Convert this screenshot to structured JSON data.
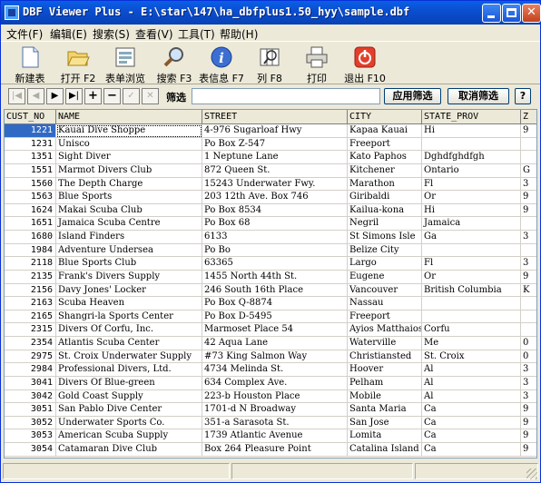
{
  "window": {
    "title": "DBF Viewer Plus - E:\\star\\147\\ha_dbfplus1.50_hyy\\sample.dbf"
  },
  "menu": [
    "文件(F)",
    "编辑(E)",
    "搜索(S)",
    "查看(V)",
    "工具(T)",
    "帮助(H)"
  ],
  "toolbar": [
    {
      "label": "新建表",
      "icon": "new-table-icon"
    },
    {
      "label": "打开 F2",
      "icon": "open-folder-icon"
    },
    {
      "label": "表单浏览",
      "icon": "form-view-icon"
    },
    {
      "label": "搜索 F3",
      "icon": "search-icon"
    },
    {
      "label": "表信息 F7",
      "icon": "info-icon"
    },
    {
      "label": "列 F8",
      "icon": "columns-icon"
    },
    {
      "label": "打印",
      "icon": "print-icon"
    },
    {
      "label": "退出 F10",
      "icon": "exit-icon"
    }
  ],
  "navigator": {
    "buttons": [
      "first-record",
      "prev-record",
      "next-record",
      "last-record",
      "add-record",
      "delete-record",
      "edit-record",
      "cancel-edit"
    ],
    "filter_label": "筛选",
    "filter_value": "",
    "apply_filter": "应用筛选",
    "cancel_filter": "取消筛选",
    "help": "?"
  },
  "grid": {
    "columns": [
      "CUST_NO",
      "NAME",
      "STREET",
      "CITY",
      "STATE_PROV",
      "Z"
    ],
    "rows": [
      [
        "1221",
        "Kauai Dive Shoppe",
        "4-976 Sugarloaf Hwy",
        "Kapaa Kauai",
        "Hi",
        "9"
      ],
      [
        "1231",
        "Unisco",
        "Po Box Z-547",
        "Freeport",
        "",
        ""
      ],
      [
        "1351",
        "Sight Diver",
        "1 Neptune Lane",
        "Kato Paphos",
        "Dghdfghdfgh",
        ""
      ],
      [
        "1551",
        "Marmot Divers Club",
        "872 Queen St.",
        "Kitchener",
        "Ontario",
        "G"
      ],
      [
        "1560",
        "The Depth Charge",
        "15243 Underwater Fwy.",
        "Marathon",
        "Fl",
        "3"
      ],
      [
        "1563",
        "Blue Sports",
        "203 12th Ave. Box 746",
        "Giribaldi",
        "Or",
        "9"
      ],
      [
        "1624",
        "Makai Scuba Club",
        "Po Box 8534",
        "Kailua-kona",
        "Hi",
        "9"
      ],
      [
        "1651",
        "Jamaica Scuba Centre",
        "Po Box 68",
        "Negril",
        "Jamaica",
        ""
      ],
      [
        "1680",
        "Island Finders",
        "6133",
        "St Simons Isle",
        "Ga",
        "3"
      ],
      [
        "1984",
        "Adventure Undersea",
        "Po Bo",
        "Belize City",
        "",
        ""
      ],
      [
        "2118",
        "Blue Sports Club",
        "63365",
        "Largo",
        "Fl",
        "3"
      ],
      [
        "2135",
        "Frank's Divers Supply",
        "1455 North 44th St.",
        "Eugene",
        "Or",
        "9"
      ],
      [
        "2156",
        "Davy Jones' Locker",
        "246 South 16th Place",
        "Vancouver",
        "British Columbia",
        "K"
      ],
      [
        "2163",
        "Scuba Heaven",
        "Po Box Q-8874",
        "Nassau",
        "",
        ""
      ],
      [
        "2165",
        "Shangri-la Sports Center",
        "Po Box D-5495",
        "Freeport",
        "",
        ""
      ],
      [
        "2315",
        "Divers Of Corfu, Inc.",
        "Marmoset Place 54",
        "Ayios Matthaios",
        "Corfu",
        ""
      ],
      [
        "2354",
        "Atlantis Scuba Center",
        "42 Aqua Lane",
        "Waterville",
        "Me",
        "0"
      ],
      [
        "2975",
        "St. Croix Underwater Supply",
        "#73 King Salmon Way",
        "Christiansted",
        "St. Croix",
        "0"
      ],
      [
        "2984",
        "Professional Divers, Ltd.",
        "4734 Melinda St.",
        "Hoover",
        "Al",
        "3"
      ],
      [
        "3041",
        "Divers Of Blue-green",
        "634 Complex Ave.",
        "Pelham",
        "Al",
        "3"
      ],
      [
        "3042",
        "Gold Coast Supply",
        "223-b Houston Place",
        "Mobile",
        "Al",
        "3"
      ],
      [
        "3051",
        "San Pablo Dive Center",
        "1701-d N Broadway",
        "Santa Maria",
        "Ca",
        "9"
      ],
      [
        "3052",
        "Underwater Sports Co.",
        "351-a Sarasota St.",
        "San Jose",
        "Ca",
        "9"
      ],
      [
        "3053",
        "American Scuba Supply",
        "1739 Atlantic Avenue",
        "Lomita",
        "Ca",
        "9"
      ],
      [
        "3054",
        "Catamaran Dive Club",
        "Box 264 Pleasure Point",
        "Catalina Island",
        "Ca",
        "9"
      ]
    ],
    "selected_row": 0
  }
}
